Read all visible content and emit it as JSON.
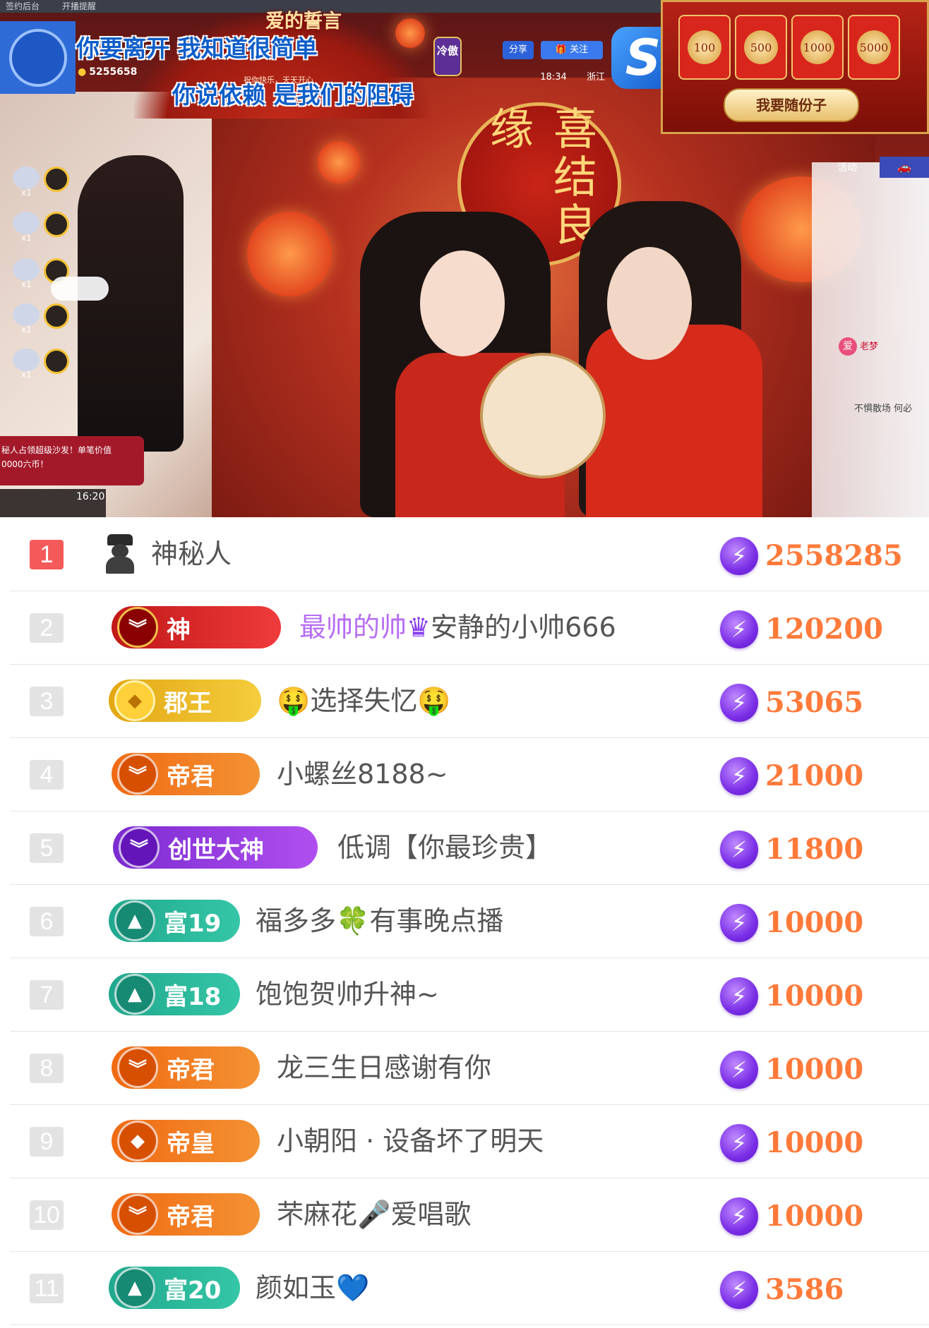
{
  "topbar": {
    "item1": "签约后台",
    "item2": "开播提醒"
  },
  "streamer": {
    "id": "5255658",
    "medal_icon": "medal-icon"
  },
  "lyrics": {
    "title": "爱的誓言",
    "line1": "你要离开  我知道很简单",
    "line2": "你说依赖  是我们的阻碍",
    "caption": "祝你快乐，天天开心"
  },
  "badge_leng": "冷傲",
  "controls": {
    "share": "分享",
    "follow": "关注",
    "time": "18:34",
    "region": "浙江"
  },
  "red_packets": {
    "amounts": [
      "100",
      "500",
      "1000",
      "5000"
    ],
    "button": "我要随份子"
  },
  "seal_text": "喜结良缘",
  "activity_tab": "活动",
  "gift_count": "x1",
  "promo": {
    "line1": "秘人占领超级沙发！单笔价值",
    "line2": "0000六币！"
  },
  "live_time": "16:20",
  "right_chat": {
    "heart": "爱",
    "name": "老梦",
    "msg2": "不惧散场 何必"
  },
  "ranking": [
    {
      "rank": "1",
      "badge": "",
      "name": "神秘人",
      "score": "2558285"
    },
    {
      "rank": "2",
      "badge": "神",
      "name_hl": "最帅的帅",
      "name": "安静的小帅666",
      "score": "120200"
    },
    {
      "rank": "3",
      "badge": "郡王",
      "name": "🤑选择失忆🤑",
      "score": "53065"
    },
    {
      "rank": "4",
      "badge": "帝君",
      "name": "小螺丝8188~",
      "score": "21000"
    },
    {
      "rank": "5",
      "badge": "创世大神",
      "name": "低调【你最珍贵】",
      "score": "11800"
    },
    {
      "rank": "6",
      "badge": "富19",
      "name": "福多多🍀有事晚点播",
      "score": "10000"
    },
    {
      "rank": "7",
      "badge": "富18",
      "name": "饱饱贺帅升神~",
      "score": "10000"
    },
    {
      "rank": "8",
      "badge": "帝君",
      "name": "龙三生日感谢有你",
      "score": "10000"
    },
    {
      "rank": "9",
      "badge": "帝皇",
      "name": "小朝阳 · 设备坏了明天",
      "score": "10000"
    },
    {
      "rank": "10",
      "badge": "帝君",
      "name": "芣麻花🎤爱唱歌",
      "score": "10000"
    },
    {
      "rank": "11",
      "badge": "富20",
      "name": "颜如玉💙",
      "score": "3586"
    }
  ],
  "colors": {
    "score": "#ff7a3a",
    "rank_first": "#f55a5a",
    "rank_default": "#e3e3e3",
    "bolt": "#7a2ee6"
  }
}
